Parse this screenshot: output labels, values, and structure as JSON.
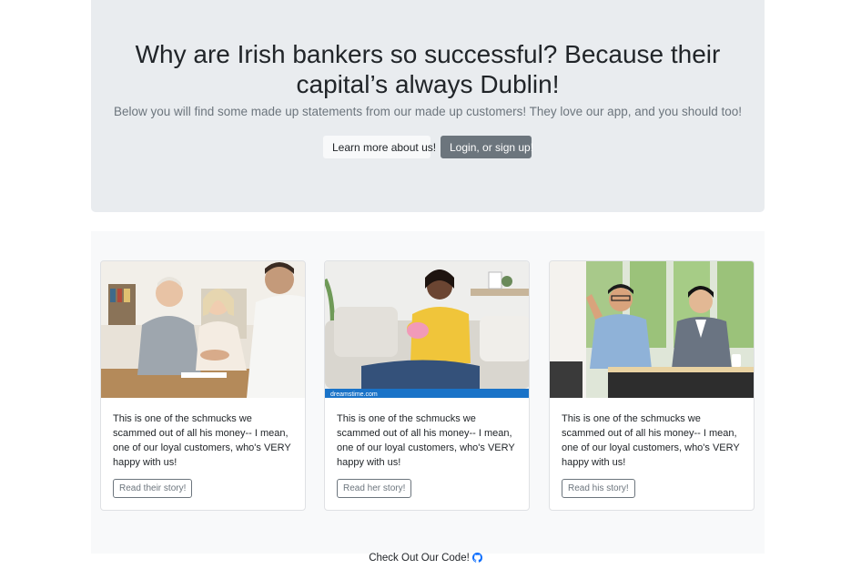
{
  "hero": {
    "title": "Why are Irish bankers so successful? Because their capital’s always Dublin!",
    "lead": "Below you will find some made up statements from our made up customers! They love our app, and you should too!",
    "learn_more_label": "Learn more about us!",
    "login_label": "Login, or sign up!"
  },
  "cards": [
    {
      "image_icon": "bankers-handshake-photo",
      "text": "This is one of the schmucks we scammed out of all his money-- I mean, one of our loyal customers, who's VERY happy with us!",
      "button_label": "Read their story!"
    },
    {
      "image_icon": "woman-piggy-bank-photo",
      "image_watermark": "dreamstime.com",
      "text": "This is one of the schmucks we scammed out of all his money-- I mean, one of our loyal customers, who's VERY happy with us!",
      "button_label": "Read her story!"
    },
    {
      "image_icon": "office-meeting-photo",
      "text": "This is one of the schmucks we scammed out of all his money-- I mean, one of our loyal customers, who's VERY happy with us!",
      "button_label": "Read his story!"
    }
  ],
  "footer": {
    "link_text": "Check Out Our Code!",
    "icon": "github-icon"
  },
  "colors": {
    "hero_bg": "#e9ecef",
    "album_bg": "#f8f9fa",
    "secondary": "#6c757d",
    "github_blue": "#0d6efd"
  }
}
